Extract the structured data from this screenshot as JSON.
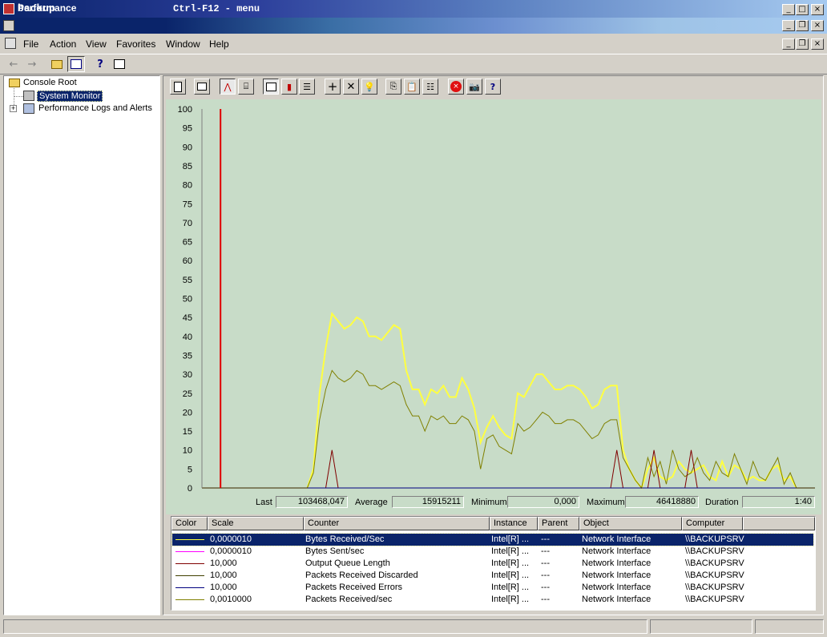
{
  "window": {
    "title": "backup",
    "center_text": "Ctrl-F12 - menu"
  },
  "mmc": {
    "title": "Performance"
  },
  "menu": [
    "File",
    "Action",
    "View",
    "Favorites",
    "Window",
    "Help"
  ],
  "tree": {
    "root": "Console Root",
    "items": [
      "System Monitor",
      "Performance Logs and Alerts"
    ]
  },
  "stats": {
    "last_label": "Last",
    "last": "103468,047",
    "average_label": "Average",
    "average": "15915211",
    "minimum_label": "Minimum",
    "minimum": "0,000",
    "maximum_label": "Maximum",
    "maximum": "46418880",
    "duration_label": "Duration",
    "duration": "1:40"
  },
  "legend": {
    "headers": [
      "Color",
      "Scale",
      "Counter",
      "Instance",
      "Parent",
      "Object",
      "Computer"
    ],
    "rows": [
      {
        "color": "#ffff40",
        "scale": "0,0000010",
        "counter": "Bytes Received/Sec",
        "instance": "Intel[R] ...",
        "parent": "---",
        "object": "Network Interface",
        "computer": "\\\\BACKUPSRV",
        "selected": true
      },
      {
        "color": "#ff00ff",
        "scale": "0,0000010",
        "counter": "Bytes Sent/sec",
        "instance": "Intel[R] ...",
        "parent": "---",
        "object": "Network Interface",
        "computer": "\\\\BACKUPSRV",
        "selected": false
      },
      {
        "color": "#800000",
        "scale": "10,000",
        "counter": "Output Queue Length",
        "instance": "Intel[R] ...",
        "parent": "---",
        "object": "Network Interface",
        "computer": "\\\\BACKUPSRV",
        "selected": false
      },
      {
        "color": "#404000",
        "scale": "10,000",
        "counter": "Packets Received Discarded",
        "instance": "Intel[R] ...",
        "parent": "---",
        "object": "Network Interface",
        "computer": "\\\\BACKUPSRV",
        "selected": false
      },
      {
        "color": "#000080",
        "scale": "10,000",
        "counter": "Packets Received Errors",
        "instance": "Intel[R] ...",
        "parent": "---",
        "object": "Network Interface",
        "computer": "\\\\BACKUPSRV",
        "selected": false
      },
      {
        "color": "#808000",
        "scale": "0,0010000",
        "counter": "Packets Received/sec",
        "instance": "Intel[R] ...",
        "parent": "---",
        "object": "Network Interface",
        "computer": "\\\\BACKUPSRV",
        "selected": false
      }
    ]
  },
  "chart_data": {
    "type": "line",
    "title": "",
    "ylim": [
      0,
      100
    ],
    "yticks": [
      0,
      5,
      10,
      15,
      20,
      25,
      30,
      35,
      40,
      45,
      50,
      55,
      60,
      65,
      70,
      75,
      80,
      85,
      90,
      95,
      100
    ],
    "x": [
      0,
      1,
      2,
      3,
      4,
      5,
      6,
      7,
      8,
      9,
      10,
      11,
      12,
      13,
      14,
      15,
      16,
      17,
      18,
      19,
      20,
      21,
      22,
      23,
      24,
      25,
      26,
      27,
      28,
      29,
      30,
      31,
      32,
      33,
      34,
      35,
      36,
      37,
      38,
      39,
      40,
      41,
      42,
      43,
      44,
      45,
      46,
      47,
      48,
      49,
      50,
      51,
      52,
      53,
      54,
      55,
      56,
      57,
      58,
      59,
      60,
      61,
      62,
      63,
      64,
      65,
      66,
      67,
      68,
      69,
      70,
      71,
      72,
      73,
      74,
      75,
      76,
      77,
      78,
      79,
      80,
      81,
      82,
      83,
      84,
      85,
      86,
      87,
      88,
      89,
      90,
      91,
      92,
      93,
      94,
      95,
      96,
      97,
      98,
      99
    ],
    "current_x": 3,
    "series": [
      {
        "name": "Bytes Received/Sec",
        "color": "#ffff40",
        "values": [
          0,
          0,
          0,
          0,
          0,
          0,
          0,
          0,
          0,
          0,
          0,
          0,
          0,
          0,
          0,
          0,
          0,
          0,
          5,
          25,
          37,
          46,
          44,
          42,
          43,
          45,
          44,
          40,
          40,
          39,
          41,
          43,
          42,
          31,
          26,
          26,
          22,
          26,
          25,
          27,
          24,
          24,
          29,
          26,
          21,
          12,
          16,
          19,
          16,
          14,
          13,
          25,
          24,
          27,
          30,
          30,
          28,
          26,
          26,
          27,
          27,
          26,
          24,
          21,
          22,
          26,
          27,
          27,
          10,
          5,
          2,
          0,
          5,
          8,
          3,
          2,
          3,
          7,
          5,
          4,
          5,
          6,
          3,
          2,
          7,
          3,
          6,
          5,
          2,
          3,
          2,
          2,
          5,
          6,
          2,
          3,
          0,
          0,
          0,
          0
        ]
      },
      {
        "name": "Packets Received/sec",
        "color": "#808000",
        "values": [
          0,
          0,
          0,
          0,
          0,
          0,
          0,
          0,
          0,
          0,
          0,
          0,
          0,
          0,
          0,
          0,
          0,
          0,
          4,
          18,
          26,
          31,
          29,
          28,
          29,
          31,
          30,
          27,
          27,
          26,
          27,
          28,
          27,
          22,
          19,
          19,
          15,
          19,
          18,
          19,
          17,
          17,
          19,
          18,
          15,
          5,
          13,
          14,
          11,
          10,
          9,
          17,
          15,
          16,
          18,
          20,
          19,
          17,
          17,
          18,
          18,
          17,
          15,
          13,
          14,
          17,
          18,
          18,
          8,
          5,
          2,
          0,
          8,
          3,
          7,
          1,
          10,
          5,
          3,
          4,
          8,
          4,
          2,
          7,
          4,
          3,
          9,
          5,
          1,
          7,
          3,
          2,
          5,
          8,
          1,
          4,
          0,
          0,
          0,
          0
        ]
      },
      {
        "name": "Output Queue Length",
        "color": "#800000",
        "values": [
          0,
          0,
          0,
          0,
          0,
          0,
          0,
          0,
          0,
          0,
          0,
          0,
          0,
          0,
          0,
          0,
          0,
          0,
          0,
          0,
          0,
          0,
          0,
          0,
          0,
          0,
          0,
          0,
          0,
          0,
          0,
          0,
          0,
          0,
          0,
          0,
          0,
          0,
          0,
          0,
          0,
          0,
          0,
          0,
          0,
          0,
          0,
          0,
          0,
          0,
          0,
          0,
          0,
          0,
          0,
          0,
          0,
          0,
          0,
          0,
          0,
          0,
          0,
          0,
          0,
          0,
          0,
          0,
          0,
          0,
          0,
          0,
          0,
          0,
          0,
          0,
          0,
          0,
          0,
          0,
          0,
          0,
          0,
          0,
          0,
          0,
          0,
          0,
          0,
          0,
          0,
          0,
          0,
          0,
          0,
          0,
          0,
          0,
          0,
          0
        ],
        "spikes": [
          {
            "x": 21,
            "y": 10
          },
          {
            "x": 67,
            "y": 10
          },
          {
            "x": 73,
            "y": 10
          },
          {
            "x": 79,
            "y": 10
          }
        ]
      },
      {
        "name": "Packets Received Errors",
        "color": "#000080",
        "values": [
          0,
          0,
          0,
          0,
          0,
          0,
          0,
          0,
          0,
          0,
          0,
          0,
          0,
          0,
          0,
          0,
          0,
          0,
          0,
          0,
          0,
          0,
          0,
          0,
          0,
          0,
          0,
          0,
          0,
          0,
          0,
          0,
          0,
          0,
          0,
          0,
          0,
          0,
          0,
          0,
          0,
          0,
          0,
          0,
          0,
          0,
          0,
          0,
          0,
          0,
          0,
          0,
          0,
          0,
          0,
          0,
          0,
          0,
          0,
          0,
          0,
          0,
          0,
          0,
          0,
          0,
          0,
          0,
          0,
          0,
          0,
          0,
          0,
          0,
          0,
          0,
          0,
          0,
          0,
          0,
          0,
          0,
          0,
          0,
          0,
          0,
          0,
          0,
          0,
          0,
          0,
          0,
          0,
          0,
          0,
          0,
          0,
          0,
          0,
          0
        ]
      }
    ]
  }
}
